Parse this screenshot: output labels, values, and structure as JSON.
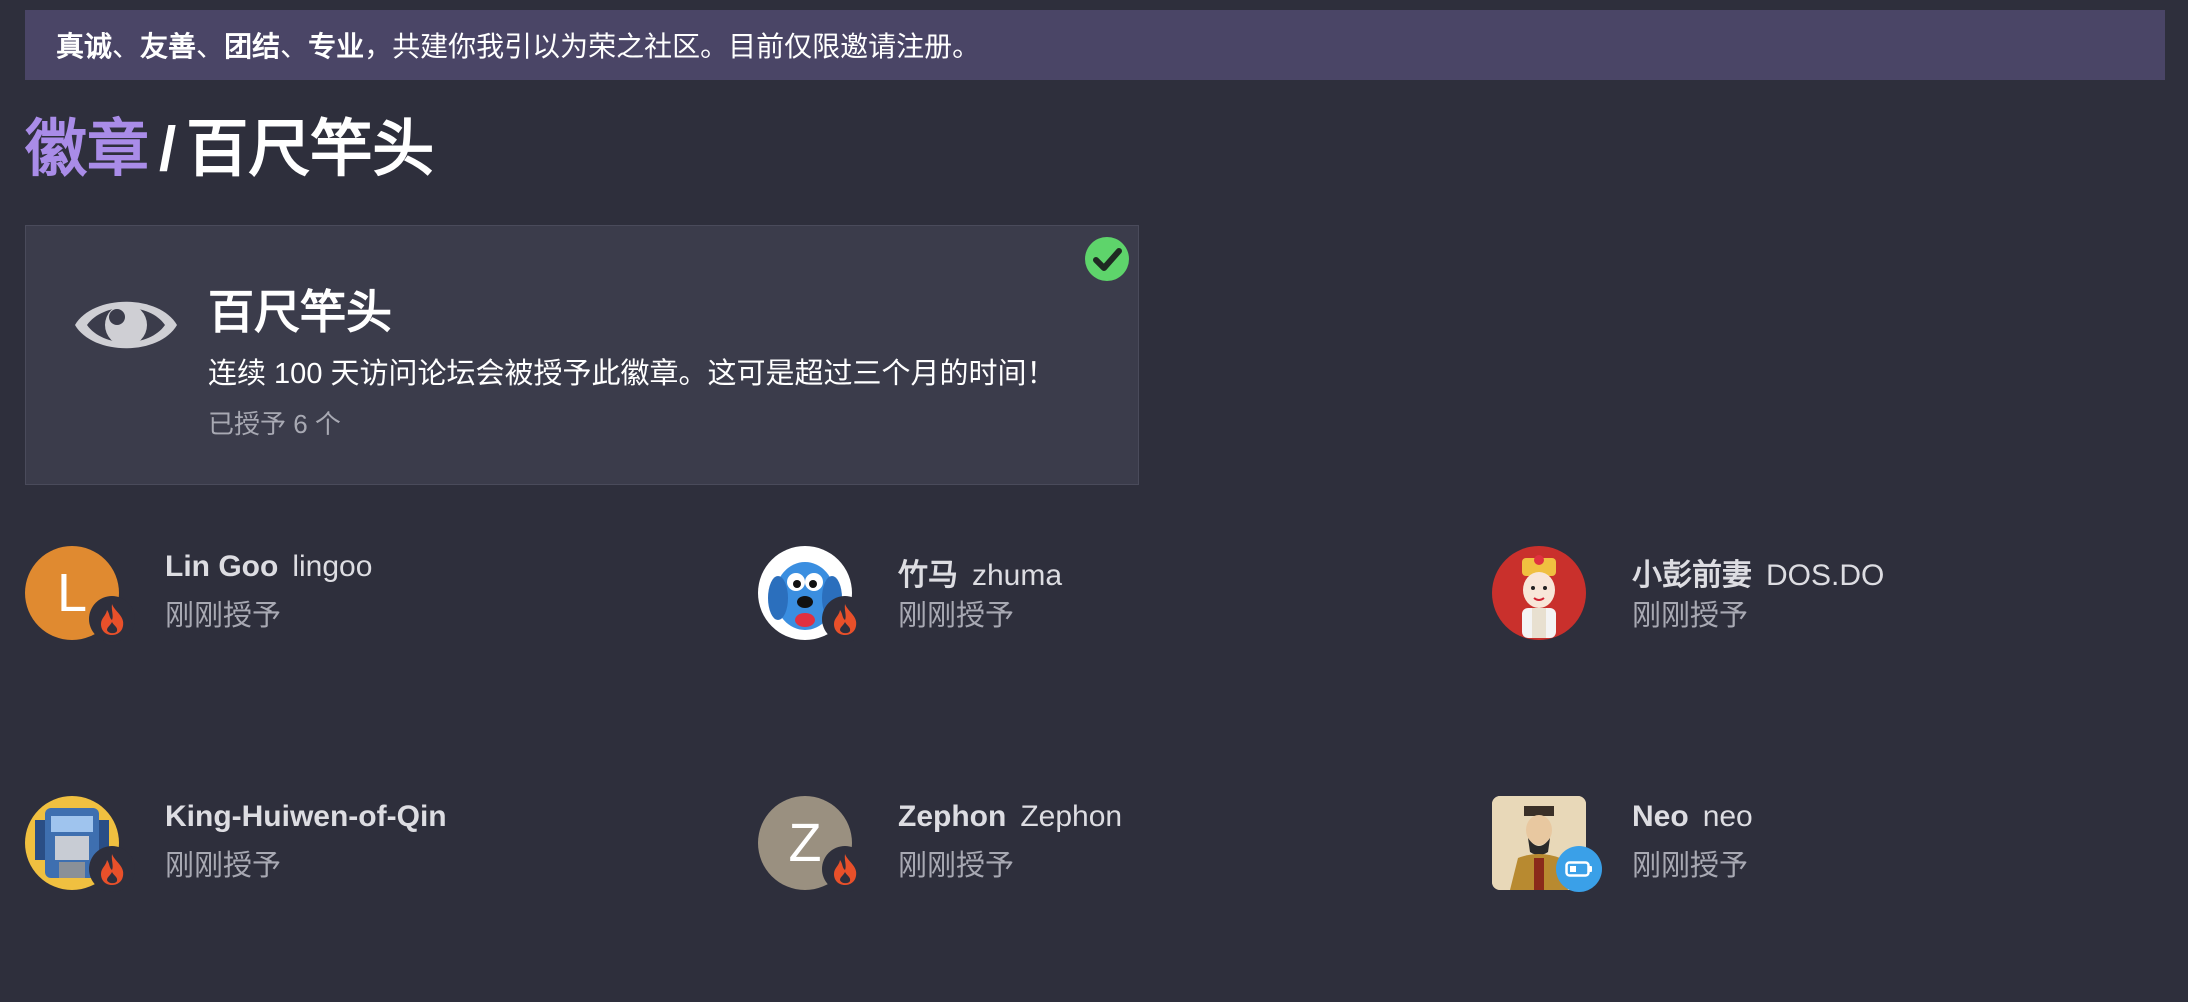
{
  "banner": {
    "bold1": "真诚",
    "sep1": "、",
    "bold2": "友善",
    "sep2": "、",
    "bold3": "团结",
    "sep3": "、",
    "bold4": "专业",
    "rest": "，共建你我引以为荣之社区。目前仅限邀请注册。"
  },
  "breadcrumb": {
    "parent": "徽章",
    "separator": "/",
    "current": "百尺竿头"
  },
  "badge": {
    "name": "百尺竿头",
    "description": "连续 100 天访问论坛会被授予此徽章。这可是超过三个月的时间！",
    "granted_count": "已授予 6 个",
    "icon": "eye-icon",
    "status_icon": "check-circle-icon"
  },
  "users": [
    {
      "name": "Lin Goo",
      "handle": "lingoo",
      "granted": "刚刚授予",
      "avatar_letter": "L",
      "avatar_color": "#e08a30",
      "flair": "fire-icon"
    },
    {
      "name": "竹马",
      "handle": "zhuma",
      "granted": "刚刚授予",
      "avatar_letter": "",
      "avatar_color": "#ffffff",
      "flair": "fire-icon"
    },
    {
      "name": "小彭前妻",
      "handle": "DOS.DO",
      "granted": "刚刚授予",
      "avatar_letter": "",
      "avatar_color": "#c9302c",
      "flair": "fire-icon"
    },
    {
      "name": "King-Huiwen-of-Qin",
      "handle": "",
      "granted": "刚刚授予",
      "avatar_letter": "",
      "avatar_color": "#f0c040",
      "flair": "fire-icon"
    },
    {
      "name": "Zephon",
      "handle": "Zephon",
      "granted": "刚刚授予",
      "avatar_letter": "Z",
      "avatar_color": "#9a9080",
      "flair": "fire-icon"
    },
    {
      "name": "Neo",
      "handle": "neo",
      "granted": "刚刚授予",
      "avatar_letter": "",
      "avatar_color": "#c8b090",
      "flair": "battery-icon"
    }
  ],
  "colors": {
    "background": "#2e2f3c",
    "banner": "#4a4566",
    "accent": "#a98ce8",
    "check": "#5ed46b",
    "fire": "#e8502a"
  }
}
